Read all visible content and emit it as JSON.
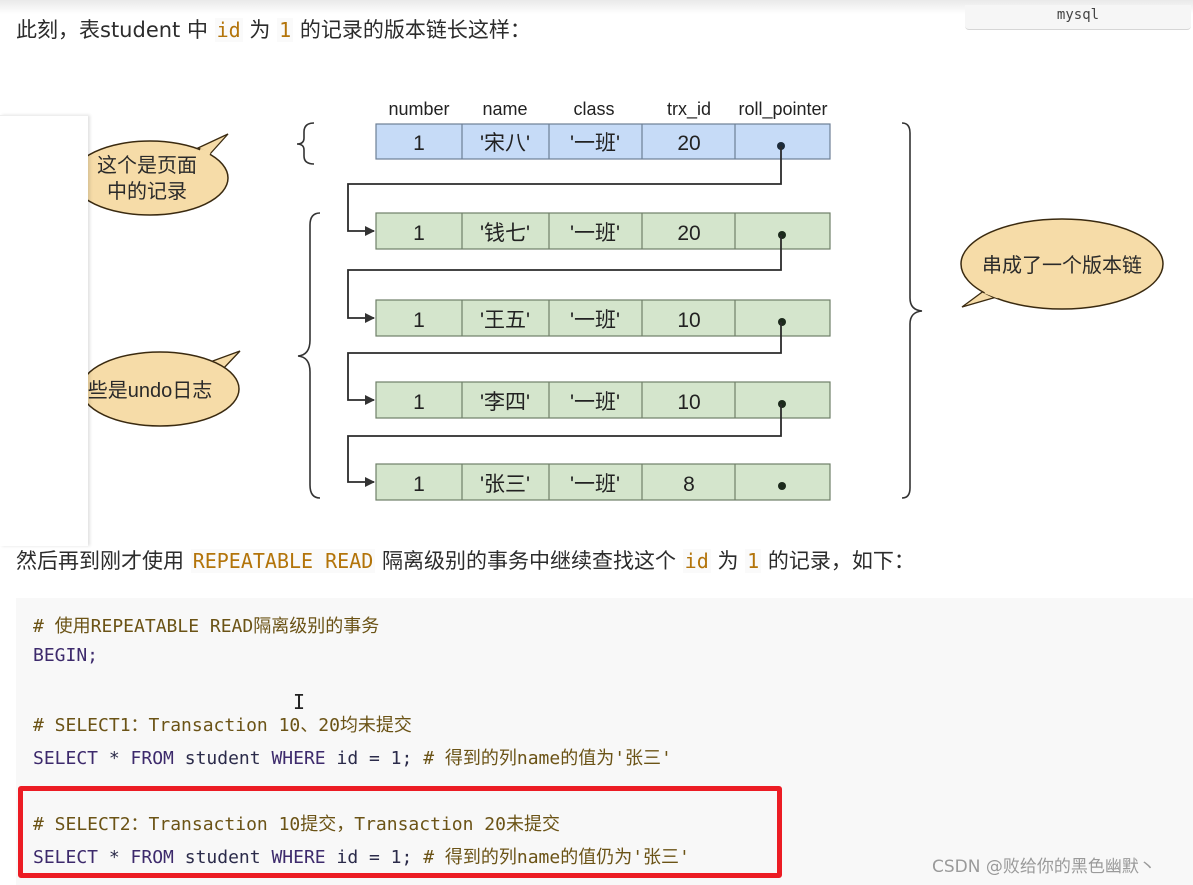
{
  "header": {
    "code_lang_label": "mysql"
  },
  "intro": {
    "prefix": "此刻，表student 中 ",
    "code1": "id",
    "mid": " 为 ",
    "code2": "1",
    "suffix": " 的记录的版本链长这样："
  },
  "diagram": {
    "columns": [
      "number",
      "name",
      "class",
      "trx_id",
      "roll_pointer"
    ],
    "page_record": {
      "number": "1",
      "name": "'宋八'",
      "class": "'一班'",
      "trx_id": "20"
    },
    "undo_records": [
      {
        "number": "1",
        "name": "'钱七'",
        "class": "'一班'",
        "trx_id": "20"
      },
      {
        "number": "1",
        "name": "'王五'",
        "class": "'一班'",
        "trx_id": "10"
      },
      {
        "number": "1",
        "name": "'李四'",
        "class": "'一班'",
        "trx_id": "10"
      },
      {
        "number": "1",
        "name": "'张三'",
        "class": "'一班'",
        "trx_id": "8"
      }
    ],
    "callouts": {
      "page_record_line1": "这个是页面",
      "page_record_line2": "中的记录",
      "undo_log": "些是undo日志",
      "version_chain": "串成了一个版本链"
    },
    "colors": {
      "page_record_fill": "#c6dbf7",
      "undo_record_fill": "#d4e5cc",
      "callout_fill": "#f6dca8"
    }
  },
  "para2": {
    "prefix": "然后再到刚才使用 ",
    "code1": "REPEATABLE READ",
    "mid": " 隔离级别的事务中继续查找这个 ",
    "code2": "id",
    "mid2": " 为 ",
    "code3": "1",
    "suffix": " 的记录，如下："
  },
  "code": {
    "line1_comment": "# 使用REPEATABLE READ隔离级别的事务",
    "line2": "BEGIN;",
    "line4_comment": "# SELECT1：Transaction 10、20均未提交",
    "line5_kw1": "SELECT",
    "line5_a": " * ",
    "line5_kw2": "FROM",
    "line5_b": " student ",
    "line5_kw3": "WHERE",
    "line5_c": " id = 1; ",
    "line5_comment": "# 得到的列name的值为'张三'",
    "line7_comment": "# SELECT2：Transaction 10提交，Transaction 20未提交",
    "line8_kw1": "SELECT",
    "line8_a": " * ",
    "line8_kw2": "FROM",
    "line8_b": " student ",
    "line8_kw3": "WHERE",
    "line8_c": " id = 1; ",
    "line8_comment": "# 得到的列name的值仍为'张三'"
  },
  "highlight_color": "#ec1c24",
  "watermark": "CSDN @败给你的黑色幽默丶"
}
